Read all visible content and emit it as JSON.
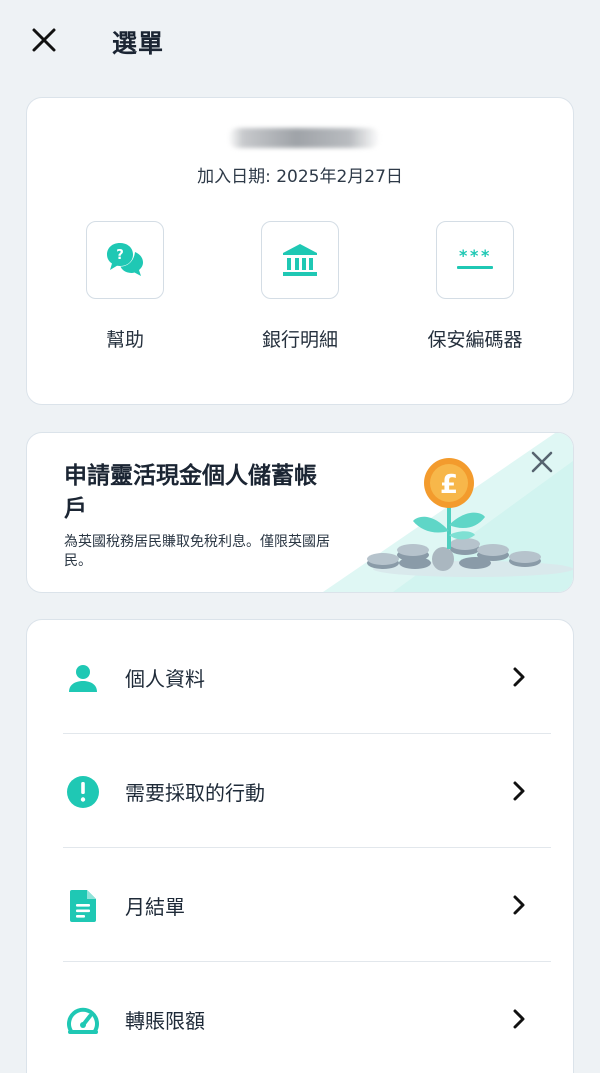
{
  "header": {
    "title": "選單",
    "close_icon": "close-icon"
  },
  "profile": {
    "join_date": "加入日期: 2025年2月27日",
    "quick_actions": [
      {
        "label": "幫助",
        "icon": "help-chat-icon"
      },
      {
        "label": "銀行明細",
        "icon": "bank-icon"
      },
      {
        "label": "保安編碼器",
        "icon": "passcode-icon"
      }
    ]
  },
  "promo": {
    "title": "申請靈活現金個人儲蓄帳戶",
    "subtitle": "為英國稅務居民賺取免稅利息。僅限英國居民。",
    "close_icon": "close-icon",
    "illustration": "pound-coin-plant-illustration"
  },
  "menu": {
    "items": [
      {
        "label": "個人資料",
        "icon": "person-icon"
      },
      {
        "label": "需要採取的行動",
        "icon": "alert-icon"
      },
      {
        "label": "月結單",
        "icon": "document-icon"
      },
      {
        "label": "轉賬限額",
        "icon": "speedometer-icon"
      }
    ]
  },
  "colors": {
    "accent": "#1fc8b4",
    "background": "#eef2f5",
    "text": "#1b2533"
  }
}
